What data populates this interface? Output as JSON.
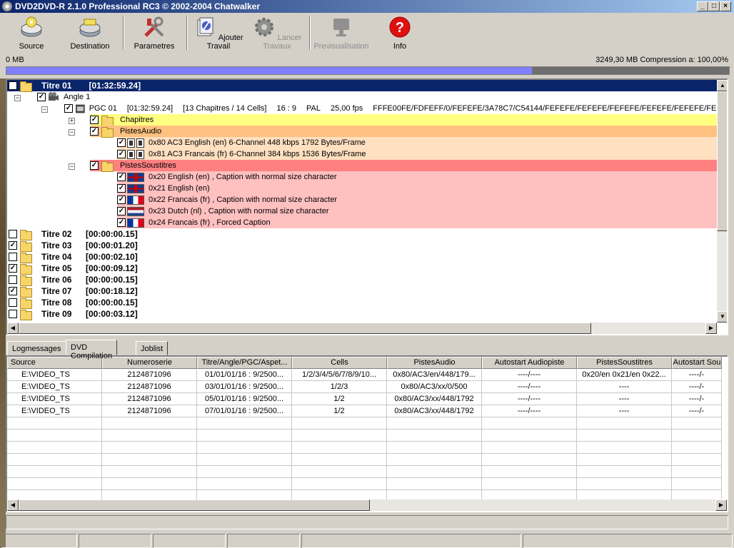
{
  "window": {
    "title": "DVD2DVD-R 2.1.0 Professional RC3 © 2002-2004 Chatwalker",
    "controls": [
      "_",
      "□",
      "×"
    ]
  },
  "toolbar": {
    "source": "Source",
    "destination": "Destination",
    "parametres": "Parametres",
    "ajouter": "Ajouter Travail",
    "lancer": "Lancer Travaux",
    "previsualisation": "Previsualisation",
    "info": "Info"
  },
  "size": {
    "left": "0 MB",
    "right": "3249,30 MB Compression a: 100,00%",
    "progress_fraction": 0.727
  },
  "tree": {
    "titre01": {
      "name": "Titre 01",
      "time": "[01:32:59.24]"
    },
    "angle": "Angle 1",
    "pgc": {
      "name": "PGC 01",
      "time": "[01:32:59.24]",
      "chapters": "[13 Chapitres / 14 Cells]",
      "aspect": "16 : 9",
      "format": "PAL",
      "fps": "25,00 fps",
      "palette": "FFFE00FE/FDFEFF/0/FEFEFE/3A78C7/C54144/FEFEFE/FEFEFE/FEFEFE/FEFEFE/FEFEFE/FEF"
    },
    "chapitres": "Chapitres",
    "pistesaudio": "PistesAudio",
    "audio": [
      "0x80 AC3 English (en) 6-Channel 448 kbps 1792 Bytes/Frame",
      "0x81 AC3 Francais (fr) 6-Channel 384 kbps 1536 Bytes/Frame"
    ],
    "pistessoustitres": "PistesSoustitres",
    "subs": [
      {
        "text": "0x20 English (en) , Caption with normal size character",
        "flag": "uk"
      },
      {
        "text": "0x21 English (en)",
        "flag": "uk"
      },
      {
        "text": "0x22 Francais (fr) , Caption with normal size character",
        "flag": "fr"
      },
      {
        "text": "0x23 Dutch (nl) , Caption with normal size character",
        "flag": "nl"
      },
      {
        "text": "0x24 Francais (fr) , Forced Caption",
        "flag": "fr"
      }
    ],
    "titles": [
      {
        "name": "Titre 02",
        "time": "[00:00:00.15]",
        "checked": false
      },
      {
        "name": "Titre 03",
        "time": "[00:00:01.20]",
        "checked": true
      },
      {
        "name": "Titre 04",
        "time": "[00:00:02.10]",
        "checked": false
      },
      {
        "name": "Titre 05",
        "time": "[00:00:09.12]",
        "checked": true
      },
      {
        "name": "Titre 06",
        "time": "[00:00:00.15]",
        "checked": false
      },
      {
        "name": "Titre 07",
        "time": "[00:00:18.12]",
        "checked": true
      },
      {
        "name": "Titre 08",
        "time": "[00:00:00.15]",
        "checked": false
      },
      {
        "name": "Titre 09",
        "time": "[00:00:03.12]",
        "checked": false
      }
    ]
  },
  "tabs": [
    "Logmessages",
    "DVD Compilation",
    "Joblist"
  ],
  "grid": {
    "columns": [
      "Source",
      "Numeroserie",
      "Titre/Angle/PGC/Aspet...",
      "Cells",
      "PistesAudio",
      "Autostart Audiopiste",
      "PistesSoustitres",
      "Autostart Sou"
    ],
    "rows": [
      [
        "E:\\VIDEO_TS",
        "2124871096",
        "01/01/01/16 : 9/2500...",
        "1/2/3/4/5/6/7/8/9/10...",
        "0x80/AC3/en/448/179...",
        "----/----",
        "0x20/en 0x21/en 0x22...",
        "----/-"
      ],
      [
        "E:\\VIDEO_TS",
        "2124871096",
        "03/01/01/16 : 9/2500...",
        "1/2/3",
        "0x80/AC3/xx/0/500",
        "----/----",
        "----",
        "----/-"
      ],
      [
        "E:\\VIDEO_TS",
        "2124871096",
        "05/01/01/16 : 9/2500...",
        "1/2",
        "0x80/AC3/xx/448/1792",
        "----/----",
        "----",
        "----/-"
      ],
      [
        "E:\\VIDEO_TS",
        "2124871096",
        "07/01/01/16 : 9/2500...",
        "1/2",
        "0x80/AC3/xx/448/1792",
        "----/----",
        "----",
        "----/-"
      ]
    ]
  }
}
